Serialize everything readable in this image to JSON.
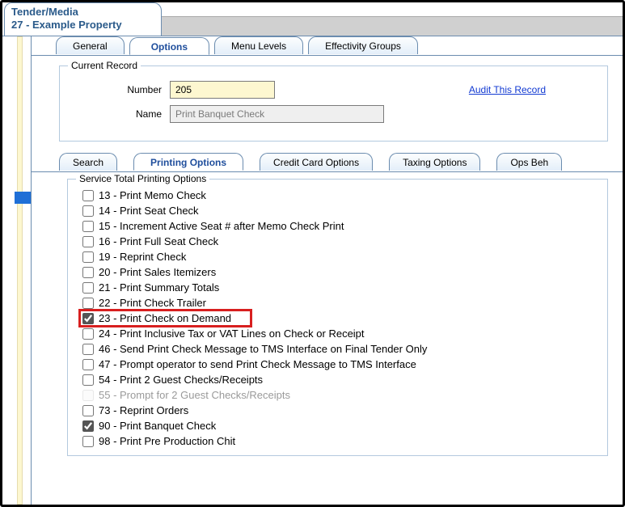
{
  "header": {
    "line1": "Tender/Media",
    "line2": "27 - Example Property"
  },
  "topTabs": [
    {
      "label": "General",
      "active": false
    },
    {
      "label": "Options",
      "active": true
    },
    {
      "label": "Menu Levels",
      "active": false
    },
    {
      "label": "Effectivity Groups",
      "active": false
    }
  ],
  "currentRecord": {
    "legend": "Current Record",
    "numberLabel": "Number",
    "numberValue": "205",
    "nameLabel": "Name",
    "nameValue": "Print Banquet Check",
    "auditLink": "Audit This Record"
  },
  "subTabs": [
    {
      "label": "Search",
      "active": false
    },
    {
      "label": "Printing Options",
      "active": true
    },
    {
      "label": "Credit Card Options",
      "active": false
    },
    {
      "label": "Taxing Options",
      "active": false
    },
    {
      "label": "Ops Beh",
      "active": false
    }
  ],
  "printingOptions": {
    "legend": "Service Total Printing Options",
    "items": [
      {
        "label": "13 - Print Memo Check",
        "checked": false,
        "disabled": false,
        "highlight": false
      },
      {
        "label": "14 - Print Seat Check",
        "checked": false,
        "disabled": false,
        "highlight": false
      },
      {
        "label": "15 - Increment Active Seat # after Memo Check Print",
        "checked": false,
        "disabled": false,
        "highlight": false
      },
      {
        "label": "16 - Print Full Seat Check",
        "checked": false,
        "disabled": false,
        "highlight": false
      },
      {
        "label": "19 - Reprint Check",
        "checked": false,
        "disabled": false,
        "highlight": false
      },
      {
        "label": "20 - Print Sales Itemizers",
        "checked": false,
        "disabled": false,
        "highlight": false
      },
      {
        "label": "21 - Print Summary Totals",
        "checked": false,
        "disabled": false,
        "highlight": false
      },
      {
        "label": "22 - Print Check Trailer",
        "checked": false,
        "disabled": false,
        "highlight": false
      },
      {
        "label": "23 - Print Check on Demand",
        "checked": true,
        "disabled": false,
        "highlight": true
      },
      {
        "label": "24 - Print Inclusive Tax or VAT Lines on Check or Receipt",
        "checked": false,
        "disabled": false,
        "highlight": false
      },
      {
        "label": "46 - Send Print Check Message to TMS Interface on Final Tender Only",
        "checked": false,
        "disabled": false,
        "highlight": false
      },
      {
        "label": "47 - Prompt operator to send Print Check Message to TMS Interface",
        "checked": false,
        "disabled": false,
        "highlight": false
      },
      {
        "label": "54 - Print 2 Guest Checks/Receipts",
        "checked": false,
        "disabled": false,
        "highlight": false
      },
      {
        "label": "55 - Prompt for 2 Guest Checks/Receipts",
        "checked": false,
        "disabled": true,
        "highlight": false
      },
      {
        "label": "73 - Reprint Orders",
        "checked": false,
        "disabled": false,
        "highlight": false
      },
      {
        "label": "90 - Print Banquet Check",
        "checked": true,
        "disabled": false,
        "highlight": false
      },
      {
        "label": "98 - Print Pre Production Chit",
        "checked": false,
        "disabled": false,
        "highlight": false
      }
    ]
  }
}
